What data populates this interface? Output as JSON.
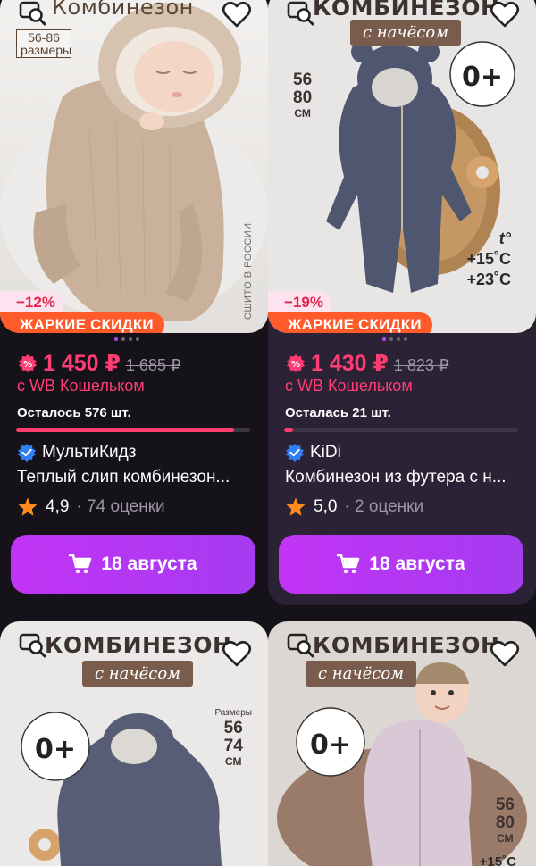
{
  "products": [
    {
      "brand_title": "Комбинезон",
      "sizes_badge": "56-86 размеры",
      "made_in": "СШИТО В РОССИИ",
      "discount": "−12%",
      "promo": "ЖАРКИЕ СКИДКИ",
      "price": "1 450 ₽",
      "old_price": "1 685 ₽",
      "with_wallet": "с WB Кошельком",
      "stock": "Осталось 576 шт.",
      "stock_fraction": 0.93,
      "seller": "МультиКидз",
      "name": "Теплый слип комбинезон...",
      "rating": "4,9",
      "reviews": "· 74 оценки",
      "cart_label": "18 августа"
    },
    {
      "brand_title": "КОМБИНЕЗОН",
      "pill": "с начёсом",
      "sizes_top": "56",
      "sizes_bottom": "80",
      "sizes_unit": "СМ",
      "badge_text": "0+",
      "temp_label": "t°",
      "temp_high": "+15˚С",
      "temp_low": "+23˚С",
      "discount": "−19%",
      "promo": "ЖАРКИЕ СКИДКИ",
      "price": "1 430 ₽",
      "old_price": "1 823 ₽",
      "with_wallet": "с WB Кошельком",
      "stock": "Осталась 21 шт.",
      "stock_fraction": 0.04,
      "seller": "KiDi",
      "name": "Комбинезон из футера с н...",
      "rating": "5,0",
      "reviews": "· 2 оценки",
      "cart_label": "18 августа"
    },
    {
      "brand_title": "КОМБИНЕЗОН",
      "pill": "с начёсом",
      "sizes_label": "Размеры",
      "sizes_top": "56",
      "sizes_bottom": "74",
      "sizes_unit": "СМ",
      "badge_text": "0+"
    },
    {
      "brand_title": "КОМБИНЕЗОН",
      "pill": "с начёсом",
      "sizes_top": "56",
      "sizes_bottom": "80",
      "sizes_unit": "СМ",
      "badge_text": "0+",
      "temp_low": "+15˚С"
    }
  ],
  "colors": {
    "background": "#151219",
    "active_card": "#2b2236",
    "price": "#ff3d74",
    "button": "#b83af3",
    "promo": "#ff5a2a"
  }
}
